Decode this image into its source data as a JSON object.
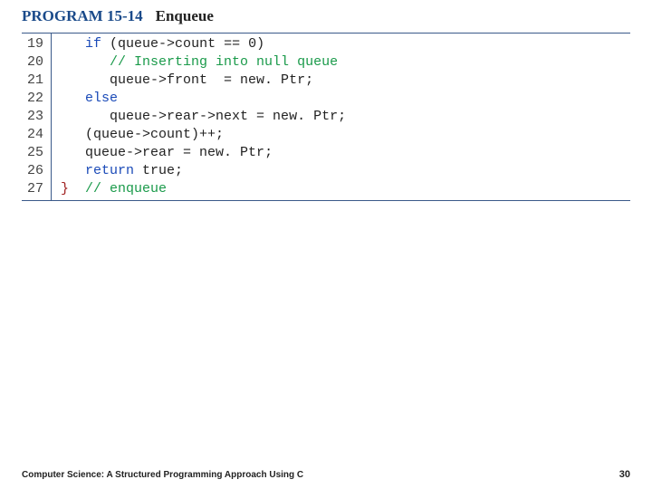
{
  "header": {
    "program_label": "PROGRAM 15-14",
    "program_title": "Enqueue"
  },
  "code": {
    "line_numbers": [
      "19",
      "20",
      "21",
      "22",
      "23",
      "24",
      "25",
      "26",
      "27"
    ],
    "lines": [
      {
        "indent": "   ",
        "brace": "",
        "tokens": [
          {
            "t": "if",
            "c": "kw"
          },
          {
            "t": " (queue->count == 0)",
            "c": ""
          }
        ]
      },
      {
        "indent": "      ",
        "brace": "",
        "tokens": [
          {
            "t": "// Inserting into null queue",
            "c": "comment"
          }
        ]
      },
      {
        "indent": "      ",
        "brace": "",
        "tokens": [
          {
            "t": "queue->front  = new. Ptr;",
            "c": ""
          }
        ]
      },
      {
        "indent": "   ",
        "brace": "",
        "tokens": [
          {
            "t": "else",
            "c": "kw"
          }
        ]
      },
      {
        "indent": "      ",
        "brace": "",
        "tokens": [
          {
            "t": "queue->rear->next = new. Ptr;",
            "c": ""
          }
        ]
      },
      {
        "indent": "   ",
        "brace": "",
        "tokens": [
          {
            "t": "(queue->count)++;",
            "c": ""
          }
        ]
      },
      {
        "indent": "   ",
        "brace": "",
        "tokens": [
          {
            "t": "queue->rear = new. Ptr;",
            "c": ""
          }
        ]
      },
      {
        "indent": "   ",
        "brace": "",
        "tokens": [
          {
            "t": "return",
            "c": "kw"
          },
          {
            "t": " true;",
            "c": ""
          }
        ]
      },
      {
        "indent": "",
        "brace": "}",
        "tokens": [
          {
            "t": "  ",
            "c": ""
          },
          {
            "t": "// enqueue",
            "c": "comment"
          }
        ]
      }
    ]
  },
  "footer": {
    "text": "Computer Science: A Structured Programming Approach Using C",
    "page": "30"
  }
}
